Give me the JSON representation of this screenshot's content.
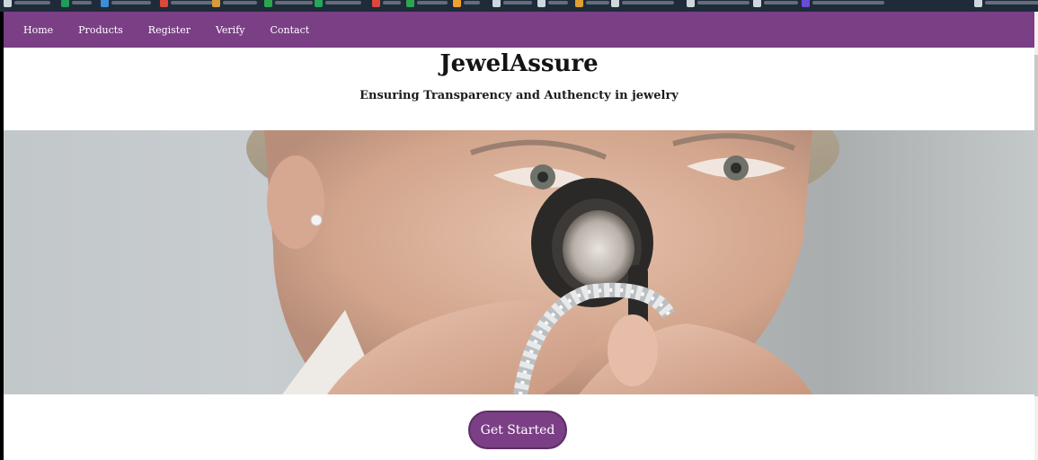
{
  "nav": {
    "items": [
      "Home",
      "Products",
      "Register",
      "Verify",
      "Contact"
    ]
  },
  "header": {
    "title": "JewelAssure",
    "tagline": "Ensuring Transparency and Authencty in jewelry"
  },
  "cta": {
    "label": "Get Started"
  },
  "colors": {
    "brand": "#7b3f86",
    "text": "#141414",
    "browser_chrome": "#202b3a"
  },
  "icons": [
    "bookmark-icon",
    "scrollbar-thumb"
  ]
}
